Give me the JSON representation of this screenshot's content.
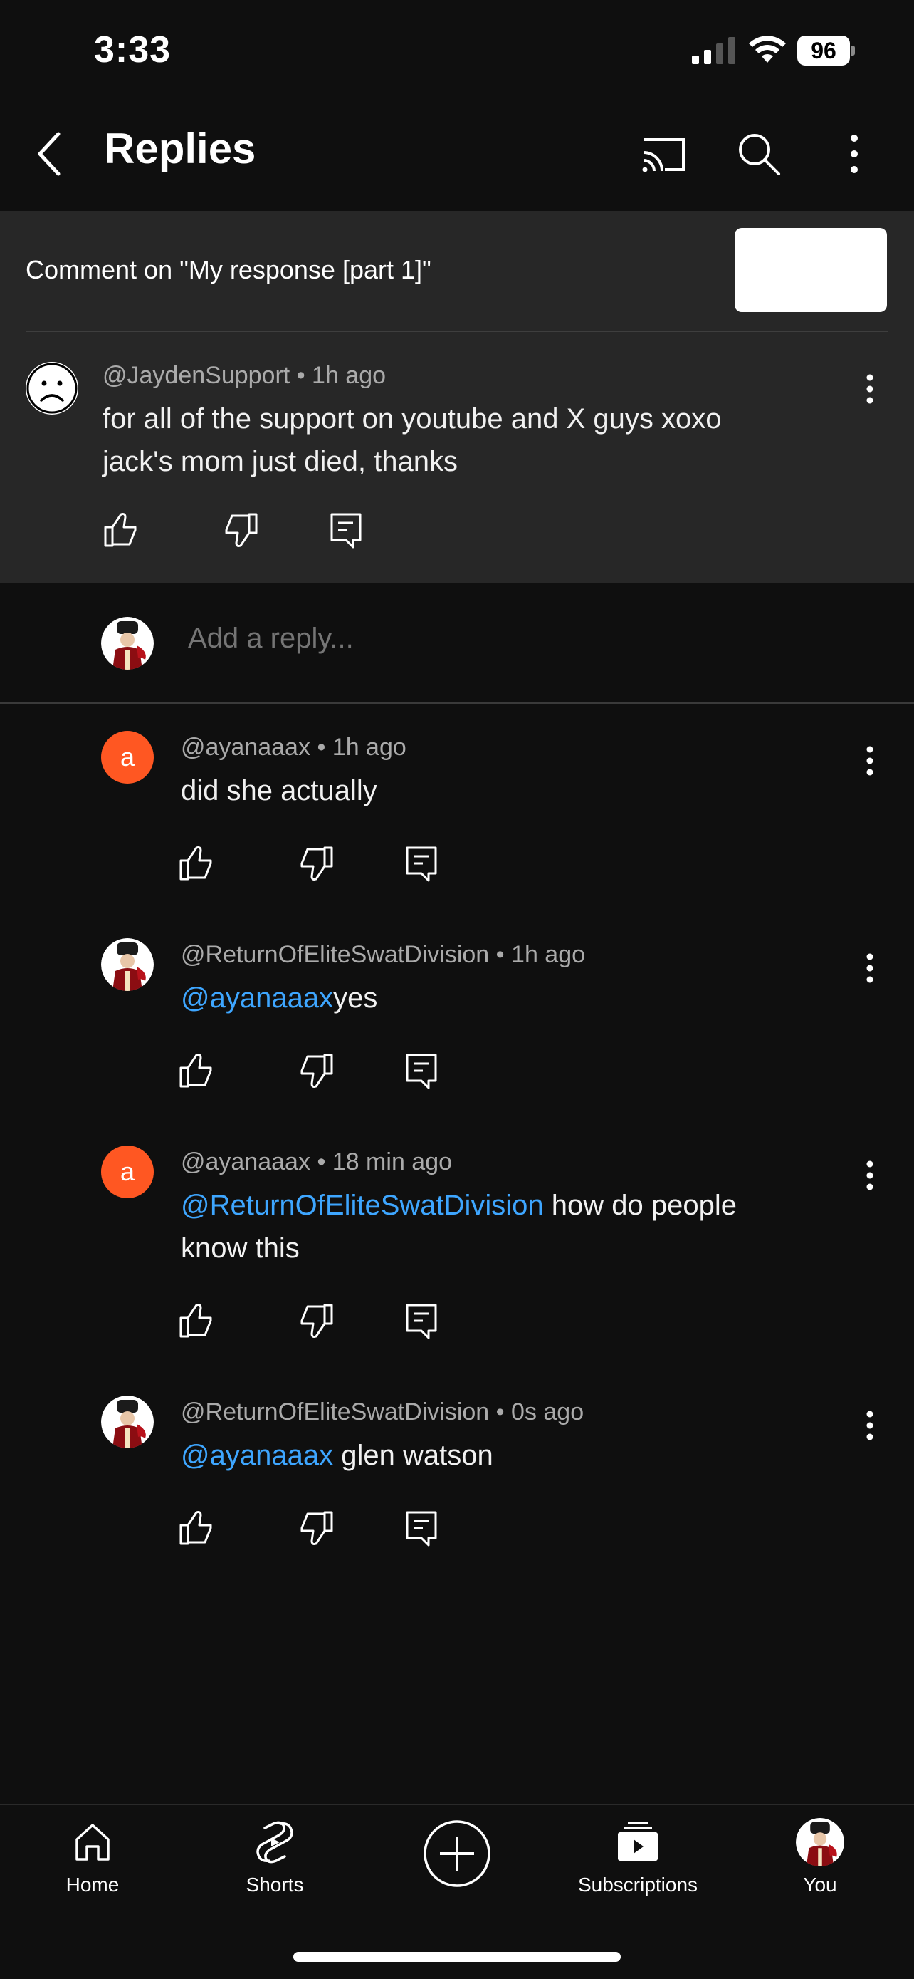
{
  "status_bar": {
    "time": "3:33",
    "battery": "96"
  },
  "header": {
    "title": "Replies"
  },
  "context": {
    "title": "Comment on \"My response [part 1]\"",
    "comment": {
      "author": "@JaydenSupport",
      "time": "1h ago",
      "text": "for all of the support on youtube and X guys xoxo jack's mom just died, thanks"
    }
  },
  "reply_box": {
    "placeholder": "Add a reply..."
  },
  "replies": [
    {
      "author": "@ayanaaax",
      "time": "1h ago",
      "avatar_letter": "a",
      "mention": "",
      "text": "did she actually"
    },
    {
      "author": "@ReturnOfEliteSwatDivision",
      "time": "1h ago",
      "mention": "@ayanaaax",
      "text": "yes"
    },
    {
      "author": "@ayanaaax",
      "time": "18 min ago",
      "avatar_letter": "a",
      "mention": "@ReturnOfEliteSwatDivision",
      "text": " how do people know this"
    },
    {
      "author": "@ReturnOfEliteSwatDivision",
      "time": "0s ago",
      "mention": "@ayanaaax",
      "text": " glen watson"
    }
  ],
  "separator": "•",
  "nav": {
    "home": "Home",
    "shorts": "Shorts",
    "subscriptions": "Subscriptions",
    "you": "You"
  },
  "colors": {
    "background": "#0f0f0f",
    "context_bg": "#272727",
    "mention": "#3ea6ff",
    "letter_avatar": "#ff5722"
  }
}
